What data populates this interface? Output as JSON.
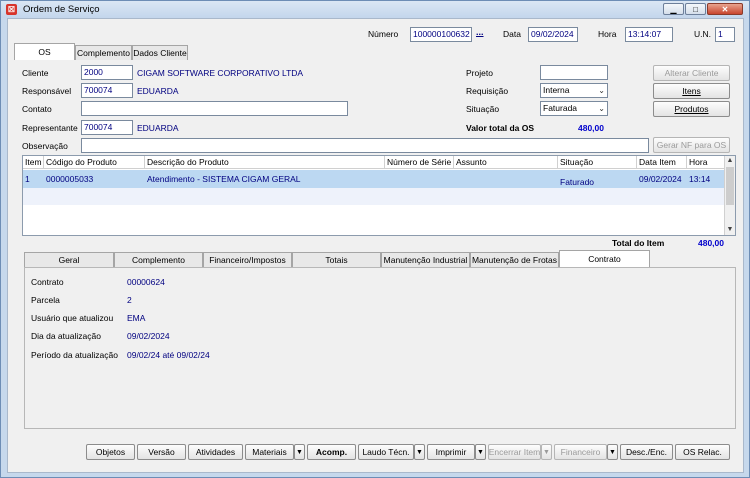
{
  "window": {
    "title": "Ordem de Serviço",
    "min": "▁",
    "max": "□",
    "close": "✕"
  },
  "header": {
    "numero_label": "Número",
    "numero_value": "100000100632",
    "numero_lookup": "...",
    "data_label": "Data",
    "data_value": "09/02/2024",
    "hora_label": "Hora",
    "hora_value": "13:14:07",
    "un_label": "U.N.",
    "un_value": "1"
  },
  "top_tabs": [
    "OS",
    "Complemento",
    "Dados Cliente"
  ],
  "form": {
    "cliente_label": "Cliente",
    "cliente_code": "2000",
    "cliente_name": "CIGAM SOFTWARE CORPORATIVO LTDA",
    "responsavel_label": "Responsável",
    "responsavel_code": "700074",
    "responsavel_name": "EDUARDA",
    "contato_label": "Contato",
    "contato_value": "",
    "representante_label": "Representante",
    "representante_code": "700074",
    "representante_name": "EDUARDA",
    "observacao_label": "Observação",
    "observacao_value": "",
    "projeto_label": "Projeto",
    "projeto_value": "",
    "requisicao_label": "Requisição",
    "requisicao_value": "Interna",
    "situacao_label": "Situação",
    "situacao_value": "Faturada",
    "valor_total_label": "Valor total da OS",
    "valor_total_value": "480,00"
  },
  "side_buttons": {
    "alterar_cliente": "Alterar Cliente",
    "itens": "Itens",
    "produtos": "Produtos",
    "gerar_nf": "Gerar NF para OS"
  },
  "grid": {
    "headers": [
      "Item",
      "Código do Produto",
      "Descrição do Produto",
      "Número de Série",
      "Assunto",
      "Situação",
      "Data Item",
      "Hora"
    ],
    "rows": [
      {
        "item": "1",
        "codigo": "0000005033",
        "descricao": "Atendimento - SISTEMA CIGAM GERAL",
        "serie": "",
        "assunto": "",
        "situacao": "Faturado",
        "data": "09/02/2024",
        "hora": "13:14"
      }
    ]
  },
  "total_item": {
    "label": "Total do Item",
    "value": "480,00"
  },
  "bottom_tabs": [
    "Geral",
    "Complemento",
    "Financeiro/Impostos",
    "Totais",
    "Manutenção Industrial",
    "Manutenção de Frotas",
    "Contrato"
  ],
  "contrato": {
    "contrato_label": "Contrato",
    "contrato_value": "00000624",
    "parcela_label": "Parcela",
    "parcela_value": "2",
    "usuario_label": "Usuário que atualizou",
    "usuario_value": "EMA",
    "dia_label": "Dia da atualização",
    "dia_value": "09/02/2024",
    "periodo_label": "Período da atualização",
    "periodo_value": "09/02/24 até 09/02/24"
  },
  "toolbar": {
    "objetos": "Objetos",
    "versao": "Versão",
    "atividades": "Atividades",
    "materiais": "Materiais",
    "acomp": "Acomp.",
    "laudo": "Laudo Técn.",
    "imprimir": "Imprimir",
    "encerrar": "Encerrar Item",
    "financeiro": "Financeiro",
    "desc_enc": "Desc./Enc.",
    "os_relac": "OS Relac.",
    "dropdown_arrow": "▼"
  },
  "colors": {
    "accent_text": "#000080",
    "selected_row": "#bcd8f2",
    "titlebar": "#c3d6ec"
  }
}
